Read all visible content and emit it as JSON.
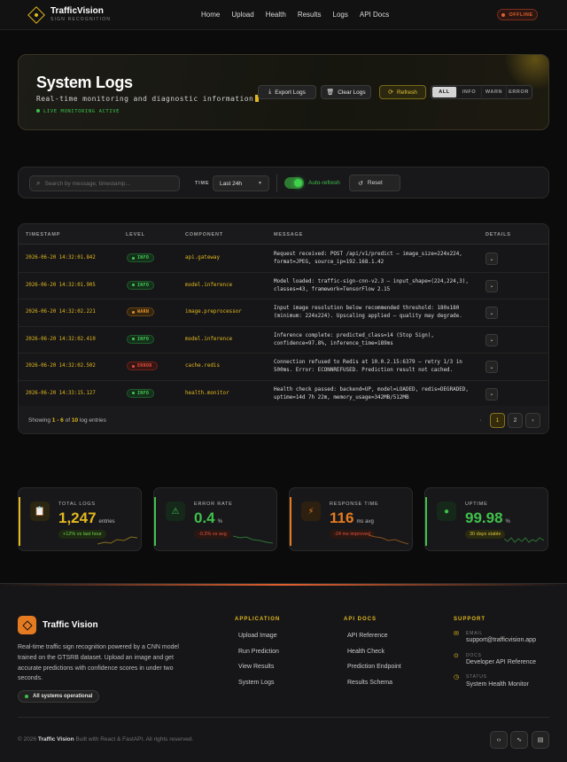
{
  "header": {
    "brand_title": "TrafficVision",
    "brand_subtitle": "SIGN RECOGNITION",
    "nav": [
      "Home",
      "Upload",
      "Health",
      "Results",
      "Logs",
      "API Docs"
    ],
    "status": "OFFLINE",
    "status_color": "#e0602f"
  },
  "hero": {
    "title": "System Logs",
    "subtitle": "Real-time monitoring and diagnostic information",
    "live": "LIVE MONITORING ACTIVE",
    "export_label": "Export Logs",
    "clear_label": "Clear Logs",
    "refresh_label": "Refresh",
    "filters": [
      "ALL",
      "INFO",
      "WARN",
      "ERROR"
    ],
    "active_filter": "ALL"
  },
  "toolbar": {
    "search_placeholder": "Search by message, timestamp...",
    "time_label": "TIME",
    "time_value": "Last 24h",
    "auto_refresh_label": "Auto-refresh",
    "auto_refresh_on": true,
    "reset_label": "Reset"
  },
  "table": {
    "columns": [
      "TIMESTAMP",
      "LEVEL",
      "COMPONENT",
      "MESSAGE",
      "DETAILS"
    ],
    "rows": [
      {
        "timestamp": "2026-06-20 14:32:01.842",
        "level": "INFO",
        "component": "api.gateway",
        "message": "Request received: POST /api/v1/predict — image_size=224x224, format=JPEG, source_ip=192.168.1.42"
      },
      {
        "timestamp": "2026-06-20 14:32:01.905",
        "level": "INFO",
        "component": "model.inference",
        "message": "Model loaded: traffic-sign-cnn-v2.3 — input_shape=(224,224,3), classes=43, framework=TensorFlow 2.15"
      },
      {
        "timestamp": "2026-06-20 14:32:02.221",
        "level": "WARN",
        "component": "image.preprocessor",
        "message": "Input image resolution below recommended threshold: 180x180 (minimum: 224x224). Upscaling applied — quality may degrade."
      },
      {
        "timestamp": "2026-06-20 14:32:02.410",
        "level": "INFO",
        "component": "model.inference",
        "message": "Inference complete: predicted_class=14 (Stop Sign), confidence=97.8%, inference_time=189ms"
      },
      {
        "timestamp": "2026-06-20 14:32:02.502",
        "level": "ERROR",
        "component": "cache.redis",
        "message": "Connection refused to Redis at 10.0.2.15:6379 — retry 1/3 in 500ms. Error: ECONNREFUSED. Prediction result not cached."
      },
      {
        "timestamp": "2026-06-20 14:33:15.127",
        "level": "INFO",
        "component": "health.monitor",
        "message": "Health check passed: backend=UP, model=LOADED, redis=DEGRADED, uptime=14d 7h 22m, memory_usage=342MB/512MB"
      }
    ],
    "showing_prefix": "Showing",
    "showing_from": "1",
    "showing_dash": "-",
    "showing_to": "6",
    "showing_of": "of",
    "showing_total": "10",
    "showing_suffix": "log entries",
    "pages": [
      "1",
      "2"
    ],
    "current_page": "1"
  },
  "stats": [
    {
      "label": "TOTAL LOGS",
      "value": "1,247",
      "unit": "entries",
      "delta": "+12% vs last hour",
      "color": "#e3b81f",
      "icon": "clipboard-icon",
      "glyph": "📋"
    },
    {
      "label": "ERROR RATE",
      "value": "0.4",
      "unit": "%",
      "delta": "-0.3% vs avg",
      "color": "#3fc04a",
      "icon": "warning-icon",
      "glyph": "⚠"
    },
    {
      "label": "RESPONSE TIME",
      "value": "116",
      "unit": "ms avg",
      "delta": "-24 ms improved",
      "color": "#e57b20",
      "icon": "lightning-icon",
      "glyph": "⚡"
    },
    {
      "label": "UPTIME",
      "value": "99.98",
      "unit": "%",
      "delta": "30 days stable",
      "color": "#3fc04a",
      "icon": "status-dot-icon",
      "glyph": "●"
    }
  ],
  "footer": {
    "title": "Traffic Vision",
    "description": "Real-time traffic sign recognition powered by a CNN model trained on the GTSRB dataset. Upload an image and get accurate predictions with confidence scores in under two seconds.",
    "status": "All systems operational",
    "application_heading": "APPLICATION",
    "application_links": [
      "Upload Image",
      "Run Prediction",
      "View Results",
      "System Logs"
    ],
    "api_heading": "API DOCS",
    "api_links": [
      "API Reference",
      "Health Check",
      "Prediction Endpoint",
      "Results Schema"
    ],
    "support_heading": "SUPPORT",
    "support": [
      {
        "label": "EMAIL",
        "value": "support@trafficvision.app",
        "icon": "mail-icon"
      },
      {
        "label": "DOCS",
        "value": "Developer API Reference",
        "icon": "pin-icon"
      },
      {
        "label": "STATUS",
        "value": "System Health Monitor",
        "icon": "clock-icon"
      }
    ],
    "copyright_prefix": "© 2026",
    "copyright_brand": "Traffic Vision",
    "copyright_suffix": "Built with React & FastAPI. All rights reserved."
  }
}
